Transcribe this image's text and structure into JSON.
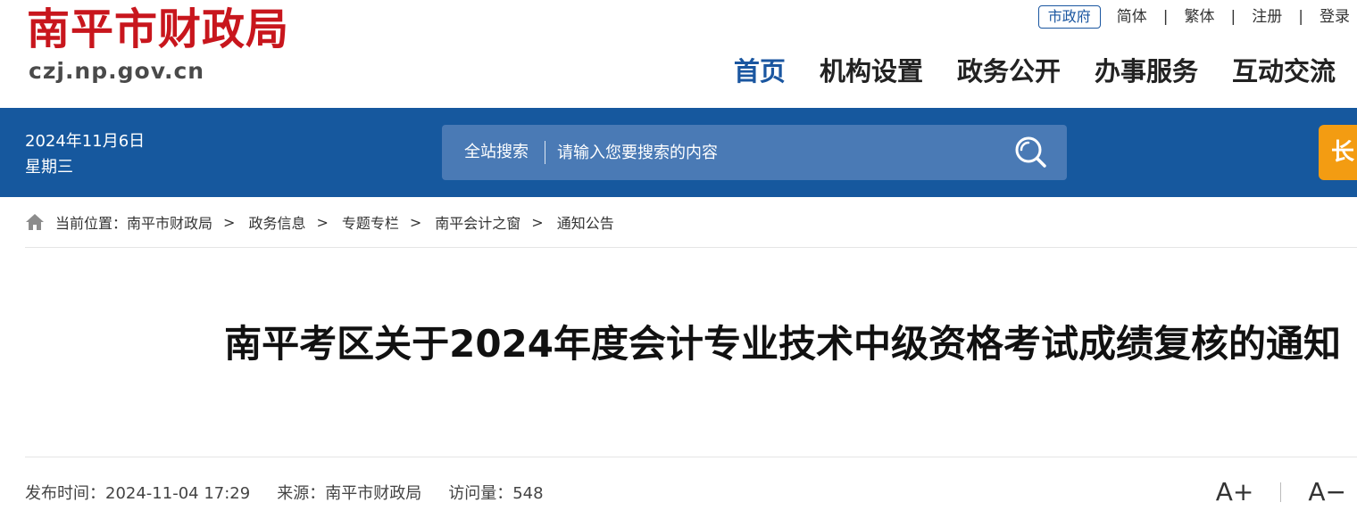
{
  "header": {
    "logo_title": "南平市财政局",
    "logo_domain": "czj.np.gov.cn",
    "top_links": {
      "city_gov": "市政府",
      "simplified": "简体",
      "traditional": "繁体",
      "register": "注册",
      "login": "登录",
      "separator": "|"
    },
    "nav": [
      {
        "label": "首页",
        "active": true
      },
      {
        "label": "机构设置",
        "active": false
      },
      {
        "label": "政务公开",
        "active": false
      },
      {
        "label": "办事服务",
        "active": false
      },
      {
        "label": "互动交流",
        "active": false
      }
    ]
  },
  "infobar": {
    "date": "2024年11月6日",
    "weekday": "星期三",
    "search_label": "全站搜索",
    "search_placeholder": "请输入您要搜索的内容",
    "side_tab_text": "长"
  },
  "breadcrumb": {
    "prefix": "当前位置：",
    "items": [
      "南平市财政局",
      "政务信息",
      "专题专栏",
      "南平会计之窗",
      "通知公告"
    ],
    "separator": ">"
  },
  "article": {
    "title": "南平考区关于2024年度会计专业技术中级资格考试成绩复核的通知",
    "publish_label": "发布时间：",
    "publish_time": "2024-11-04 17:29",
    "source_label": "来源：",
    "source": "南平市财政局",
    "views_label": "访问量：",
    "views": "548",
    "font_increase": "A+",
    "font_decrease": "A−"
  },
  "colors": {
    "brand_red": "#c8161d",
    "brand_blue": "#16589e",
    "accent_orange": "#f39c12"
  },
  "icons": [
    "home-icon",
    "search-icon"
  ]
}
